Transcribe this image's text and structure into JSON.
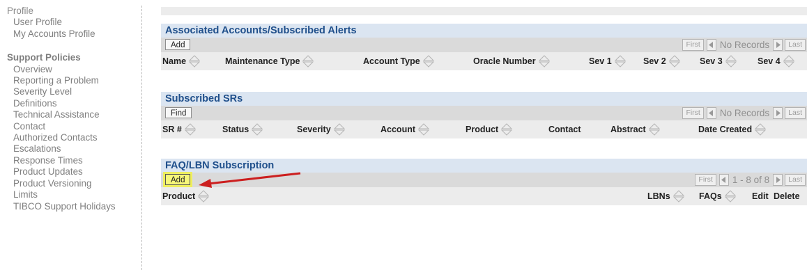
{
  "sidebar": {
    "profile_title": "Profile",
    "profile_links": [
      "User Profile",
      "My Accounts Profile"
    ],
    "support_title": "Support Policies",
    "support_links": [
      "Overview",
      "Reporting a Problem",
      "Severity Level",
      "Definitions",
      "Technical Assistance",
      "Contact",
      "Authorized Contacts",
      "Escalations",
      "Response Times",
      "Product Updates",
      "Product Versioning",
      "Limits",
      "TIBCO Support Holidays"
    ]
  },
  "panels": {
    "accounts": {
      "title": "Associated Accounts/Subscribed Alerts",
      "button": "Add",
      "pager": {
        "first": "First",
        "status": "No Records",
        "last": "Last"
      },
      "columns": [
        "Name",
        "Maintenance Type",
        "Account Type",
        "Oracle Number",
        "Sev 1",
        "Sev 2",
        "Sev 3",
        "Sev 4"
      ]
    },
    "srs": {
      "title": "Subscribed SRs",
      "button": "Find",
      "pager": {
        "first": "First",
        "status": "No Records",
        "last": "Last"
      },
      "columns": [
        "SR #",
        "Status",
        "Severity",
        "Account",
        "Product",
        "Contact",
        "Abstract",
        "Date Created"
      ]
    },
    "faq": {
      "title": "FAQ/LBN Subscription",
      "button": "Add",
      "pager": {
        "first": "First",
        "status": "1 - 8 of 8",
        "last": "Last"
      },
      "columns": [
        "Product",
        "LBNs",
        "FAQs",
        "Edit",
        "Delete"
      ]
    }
  },
  "icons": {
    "sort": "sort-icon",
    "prev": "prev-page-icon",
    "next": "next-page-icon",
    "annotation": "red-arrow-icon"
  },
  "colors": {
    "panel_title_bg": "#dbe5f1",
    "panel_title_text": "#1f4f8b",
    "highlight": "#f7f77a",
    "annotation": "#cc1f1f"
  }
}
